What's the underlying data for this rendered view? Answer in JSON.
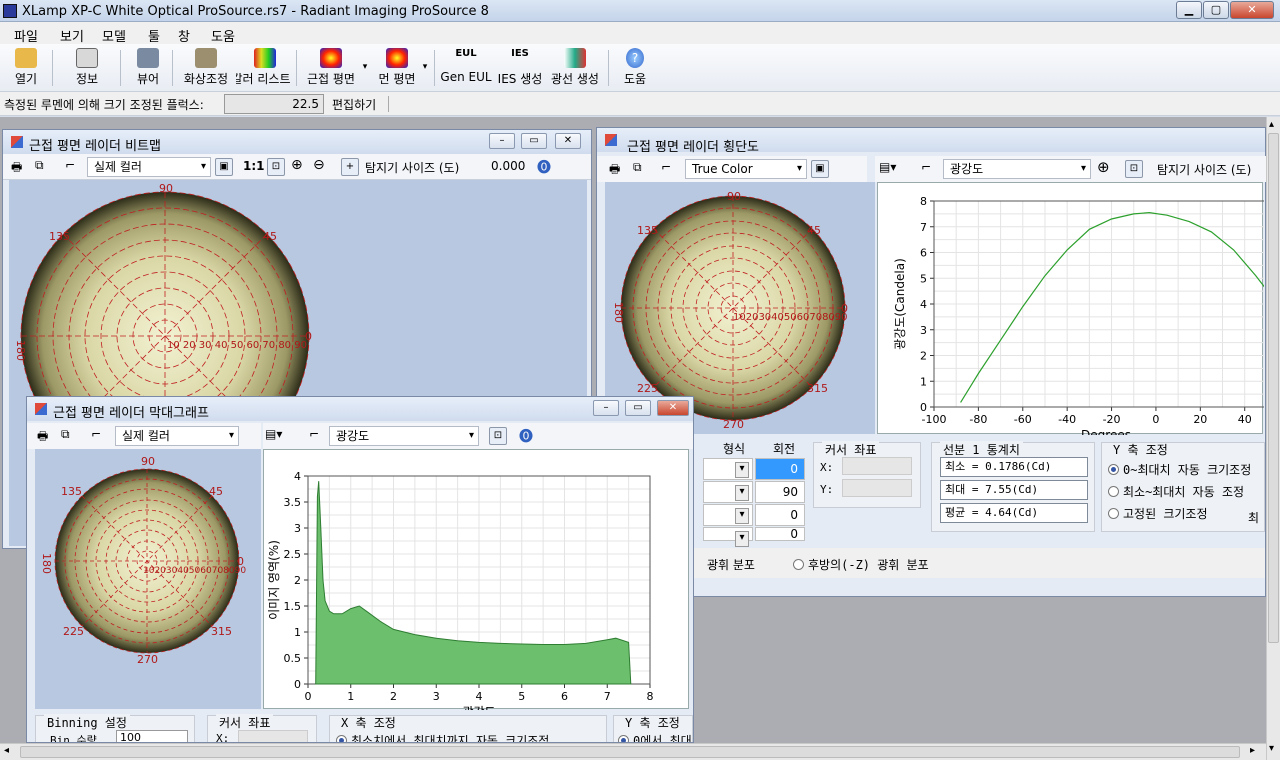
{
  "app": {
    "title": "XLamp XP-C White Optical ProSource.rs7 - Radiant Imaging ProSource 8"
  },
  "menu": [
    "파일",
    "보기",
    "모델",
    "툴",
    "창",
    "도움"
  ],
  "toolbar": [
    {
      "label": "열기",
      "icon": "open-folder-icon"
    },
    {
      "label": "정보",
      "icon": "info-icon"
    },
    {
      "label": "뷰어",
      "icon": "viewer-icon"
    },
    {
      "label": "화상조정",
      "icon": "image-adjust-icon"
    },
    {
      "label": "칼러 리스트",
      "icon": "color-list-icon"
    },
    {
      "label": "근접 평면",
      "icon": "near-field-icon"
    },
    {
      "label": "먼 평면",
      "icon": "far-field-icon"
    },
    {
      "label": "Gen EUL",
      "icon": "eul-icon"
    },
    {
      "label": "IES 생성",
      "icon": "ies-icon"
    },
    {
      "label": "광선 생성",
      "icon": "ray-icon"
    },
    {
      "label": "도움",
      "icon": "help-icon"
    }
  ],
  "flux": {
    "label": "측정된 루멘에 의해 크기 조정된 플럭스:",
    "value": "22.5",
    "edit": "편집하기"
  },
  "win_bitmap": {
    "title": "근접 평면 레이더 비트맵",
    "color_mode": "실제 컬러",
    "scale": "1:1",
    "detector_label": "탐지기 사이즈 (도)",
    "detector_value": "0.000"
  },
  "win_cross": {
    "title": "근접 평면 레이더 횡단도",
    "color_mode": "True Color",
    "quantity": "광강도",
    "detector_label": "탐지기 사이즈 (도)",
    "cursor": {
      "title": "커서 좌표",
      "x": "X:",
      "y": "Y:"
    },
    "stats": {
      "title": "선분 1 통계치",
      "min": "최소 = 0.1786(Cd)",
      "max": "최대 = 7.55(Cd)",
      "avg": "평균 = 4.64(Cd)"
    },
    "yaxis": {
      "title": "Y 축 조정",
      "opt1": "0~최대치 자동 크기조정",
      "opt2": "최소~최대치  자동 조정",
      "opt3": "고정된 크기조정",
      "clip": "최"
    },
    "table": {
      "h1": "형식",
      "h2": "회전",
      "rows": [
        "0",
        "90",
        "0",
        "0"
      ]
    },
    "bottom": {
      "opt1": "광휘 분포",
      "opt2": "후방의(-Z) 광휘 분포"
    }
  },
  "win_hist": {
    "title": "근접 평면 레이더 막대그래프",
    "color_mode": "실제 컬러",
    "quantity": "광강도",
    "binning": {
      "title": "Binning 설정",
      "label": "Bin 수량",
      "value": "100"
    },
    "cursor": {
      "title": "커서 좌표",
      "x": "X:"
    },
    "xaxis": {
      "title": "X 축 조정",
      "opt1": "최소치에서 최대치까지 자동 크기조정"
    },
    "yaxis": {
      "title": "Y 축 조정",
      "opt1": "0에서 최대"
    }
  },
  "polar_labels": {
    "a90": "90",
    "a45": "45",
    "a135": "135",
    "a180": "180",
    "a0": "0",
    "a225": "225",
    "a315": "315",
    "a270": "270",
    "rings": "10 20 30 40 50 60 70 80 90",
    "rings_compact": "102030405060708090"
  },
  "chart_data": [
    {
      "type": "line",
      "xlabel": "Degrees",
      "ylabel": "광강도(Candela)",
      "xlim": [
        -100,
        55
      ],
      "ylim": [
        0,
        8
      ],
      "xticks": [
        -100,
        -80,
        -60,
        -40,
        -20,
        0,
        20,
        40
      ],
      "yticks": [
        0,
        1,
        2,
        3,
        4,
        5,
        6,
        7,
        8
      ],
      "grid": true,
      "color": "#2ca02c",
      "x": [
        -88,
        -85,
        -80,
        -70,
        -60,
        -50,
        -40,
        -30,
        -20,
        -10,
        -3,
        5,
        15,
        25,
        35,
        45,
        53
      ],
      "y": [
        0.18,
        0.6,
        1.3,
        2.6,
        3.9,
        5.1,
        6.1,
        6.9,
        7.3,
        7.5,
        7.55,
        7.45,
        7.2,
        6.8,
        6.1,
        5.1,
        4.2
      ]
    },
    {
      "type": "area",
      "xlabel": "광강도",
      "ylabel": "이미지 영역(%)",
      "xlim": [
        0,
        8
      ],
      "ylim": [
        0,
        4
      ],
      "xticks": [
        0,
        1,
        2,
        3,
        4,
        5,
        6,
        7,
        8
      ],
      "yticks": [
        0,
        0.5,
        1,
        1.5,
        2,
        2.5,
        3,
        3.5,
        4
      ],
      "grid": true,
      "color": "#6cbf6c",
      "x": [
        0.18,
        0.22,
        0.25,
        0.3,
        0.35,
        0.4,
        0.5,
        0.6,
        0.8,
        1.0,
        1.2,
        1.4,
        1.7,
        2.0,
        2.5,
        3.0,
        3.5,
        4.0,
        4.5,
        5.0,
        5.5,
        6.0,
        6.5,
        7.0,
        7.2,
        7.5,
        7.55
      ],
      "y": [
        0,
        3.6,
        3.9,
        3.0,
        2.0,
        1.6,
        1.4,
        1.35,
        1.35,
        1.45,
        1.5,
        1.38,
        1.2,
        1.05,
        0.95,
        0.88,
        0.83,
        0.8,
        0.78,
        0.77,
        0.76,
        0.76,
        0.78,
        0.85,
        0.88,
        0.8,
        0
      ]
    }
  ]
}
